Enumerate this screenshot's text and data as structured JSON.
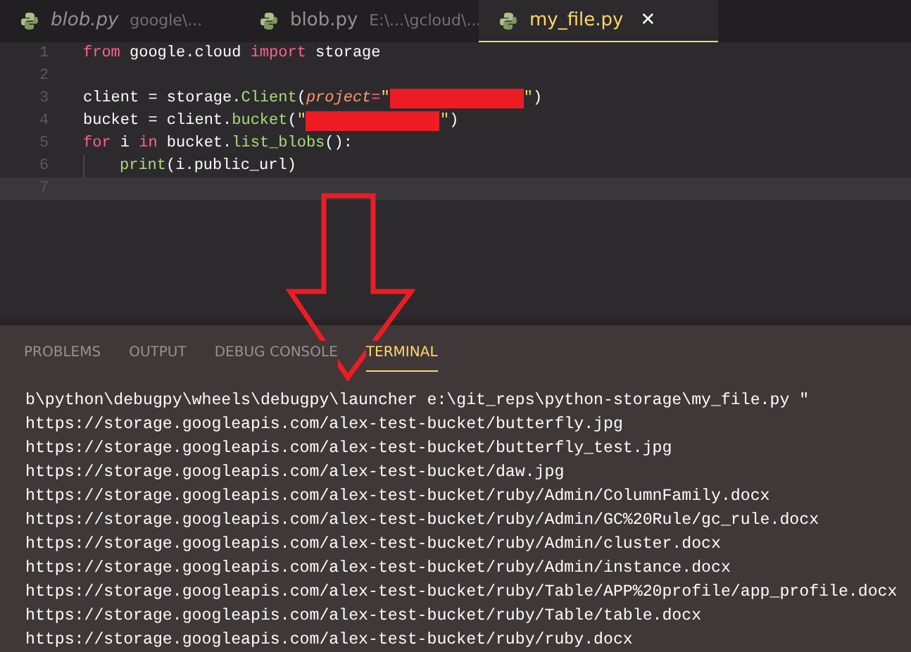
{
  "editor_tabs": [
    {
      "label": "blob.py",
      "description": "google\\...",
      "preview": true,
      "selected": false
    },
    {
      "label": "blob.py",
      "description": "E:\\...\\gcloud\\...",
      "preview": false,
      "selected": false
    },
    {
      "label": "my_file.py",
      "close": "✕",
      "preview": false,
      "selected": true
    }
  ],
  "code_lines": [
    {
      "number": "1",
      "tokens": [
        {
          "kind": "keyword",
          "text": "from"
        },
        {
          "kind": "plain",
          "text": " google.cloud "
        },
        {
          "kind": "keyword",
          "text": "import"
        },
        {
          "kind": "plain",
          "text": " storage"
        }
      ]
    },
    {
      "number": "2"
    },
    {
      "number": "3",
      "tokens": [
        {
          "kind": "plain",
          "text": "client = storage."
        },
        {
          "kind": "func",
          "text": "Client"
        },
        {
          "kind": "plain",
          "text": "("
        },
        {
          "kind": "param",
          "text": "project"
        },
        {
          "kind": "operator",
          "text": "="
        },
        {
          "kind": "string",
          "text": "\""
        },
        {
          "kind": "redacted"
        },
        {
          "kind": "string",
          "text": "\""
        },
        {
          "kind": "plain",
          "text": ")"
        }
      ]
    },
    {
      "number": "4",
      "tokens": [
        {
          "kind": "plain",
          "text": "bucket = client."
        },
        {
          "kind": "func",
          "text": "bucket"
        },
        {
          "kind": "plain",
          "text": "("
        },
        {
          "kind": "string",
          "text": "\""
        },
        {
          "kind": "redacted"
        },
        {
          "kind": "string",
          "text": "\""
        },
        {
          "kind": "plain",
          "text": ")"
        }
      ]
    },
    {
      "number": "5",
      "tokens": [
        {
          "kind": "keyword",
          "text": "for"
        },
        {
          "kind": "plain",
          "text": " i "
        },
        {
          "kind": "keyword",
          "text": "in"
        },
        {
          "kind": "plain",
          "text": " bucket."
        },
        {
          "kind": "func",
          "text": "list_blobs"
        },
        {
          "kind": "plain",
          "text": "():"
        }
      ]
    },
    {
      "number": "6",
      "indent": true,
      "tokens": [
        {
          "kind": "func",
          "text": "print"
        },
        {
          "kind": "plain",
          "text": "(i.public_url)"
        }
      ]
    },
    {
      "number": "7",
      "current": true
    }
  ],
  "panel_tabs": [
    {
      "label": "PROBLEMS",
      "selected": false
    },
    {
      "label": "OUTPUT",
      "selected": false
    },
    {
      "label": "DEBUG CONSOLE",
      "selected": false
    },
    {
      "label": "TERMINAL",
      "selected": true
    }
  ],
  "terminal_lines": [
    "b\\python\\debugpy\\wheels\\debugpy\\launcher e:\\git_reps\\python-storage\\my_file.py \"",
    "https://storage.googleapis.com/alex-test-bucket/butterfly.jpg",
    "https://storage.googleapis.com/alex-test-bucket/butterfly_test.jpg",
    "https://storage.googleapis.com/alex-test-bucket/daw.jpg",
    "https://storage.googleapis.com/alex-test-bucket/ruby/Admin/ColumnFamily.docx",
    "https://storage.googleapis.com/alex-test-bucket/ruby/Admin/GC%20Rule/gc_rule.docx",
    "https://storage.googleapis.com/alex-test-bucket/ruby/Admin/cluster.docx",
    "https://storage.googleapis.com/alex-test-bucket/ruby/Admin/instance.docx",
    "https://storage.googleapis.com/alex-test-bucket/ruby/Table/APP%20profile/app_profile.docx",
    "https://storage.googleapis.com/alex-test-bucket/ruby/Table/table.docx",
    "https://storage.googleapis.com/alex-test-bucket/ruby/ruby.docx"
  ]
}
